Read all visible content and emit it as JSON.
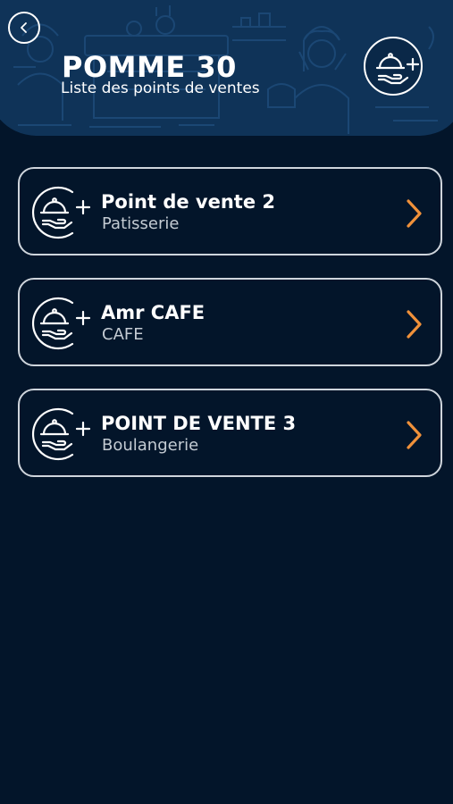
{
  "header": {
    "title": "POMME 30",
    "subtitle": "Liste des points de ventes",
    "back_icon": "chevron-left-icon",
    "add_icon": "serving-cloche-plus-icon"
  },
  "points_de_vente": [
    {
      "name": "Point de vente 2",
      "type": "Patisserie",
      "icon": "serving-cloche-plus-icon"
    },
    {
      "name": "Amr CAFE",
      "type": "CAFE",
      "icon": "serving-cloche-plus-icon"
    },
    {
      "name": "POINT DE VENTE 3",
      "type": "Boulangerie",
      "icon": "serving-cloche-plus-icon"
    }
  ],
  "colors": {
    "background": "#03152a",
    "header_background": "#0f3358",
    "card_border": "#cfd5dc",
    "accent_chevron": "#f0913a",
    "text_primary": "#ffffff",
    "text_secondary": "#c4cbd3"
  }
}
